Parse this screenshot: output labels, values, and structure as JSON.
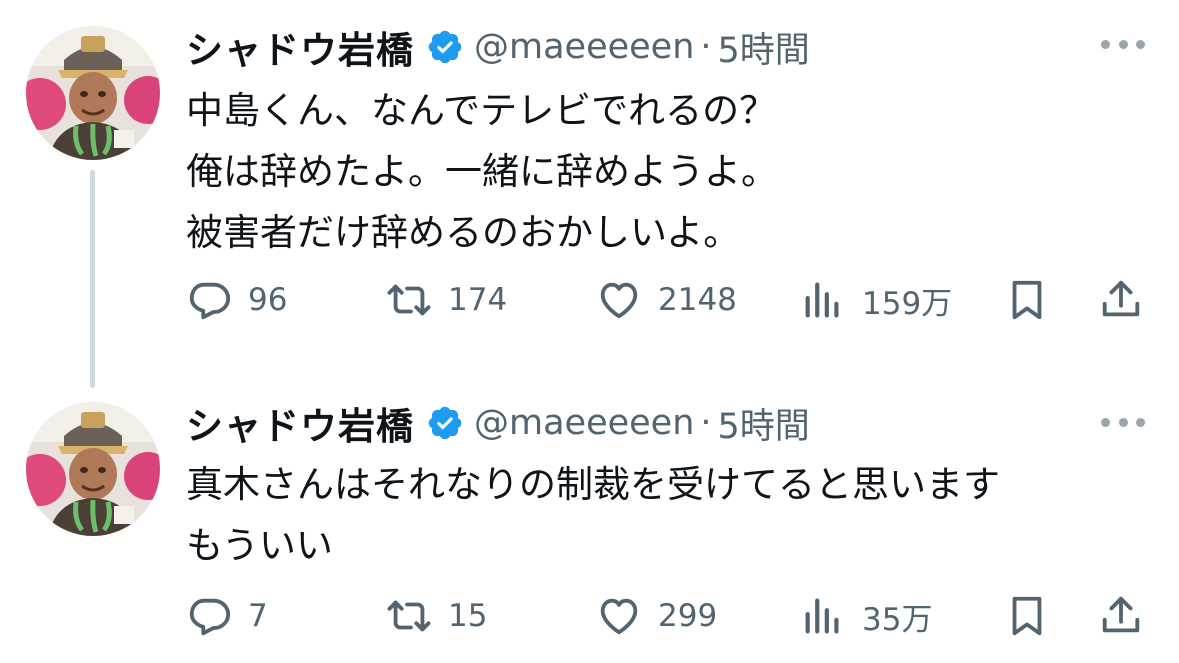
{
  "colors": {
    "text_primary": "#0f1419",
    "text_secondary": "#536471",
    "verified_blue": "#1d9bf0",
    "thread_line": "#cfd9de"
  },
  "tweets": [
    {
      "author": {
        "display_name": "シャドウ岩橋",
        "handle": "@maeeeeen",
        "verified": true
      },
      "separator": "·",
      "time": "5時間",
      "lines": [
        "中島くん、なんでテレビでれるの？",
        "俺は辞めたよ。一緒に辞めようよ。",
        "被害者だけ辞めるのおかしいよ。"
      ],
      "stats": {
        "replies": "96",
        "reposts": "174",
        "likes": "2148",
        "views": "159万"
      },
      "icons": [
        "reply-icon",
        "repost-icon",
        "like-icon",
        "views-icon",
        "bookmark-icon",
        "share-icon"
      ]
    },
    {
      "author": {
        "display_name": "シャドウ岩橋",
        "handle": "@maeeeeen",
        "verified": true
      },
      "separator": "·",
      "time": "5時間",
      "lines": [
        "真木さんはそれなりの制裁を受けてると思います",
        "もういい"
      ],
      "stats": {
        "replies": "7",
        "reposts": "15",
        "likes": "299",
        "views": "35万"
      },
      "icons": [
        "reply-icon",
        "repost-icon",
        "like-icon",
        "views-icon",
        "bookmark-icon",
        "share-icon"
      ]
    }
  ]
}
